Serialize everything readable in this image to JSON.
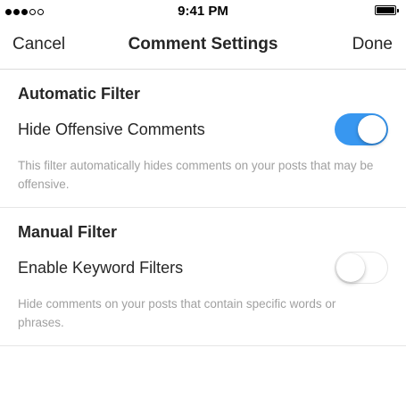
{
  "status_bar": {
    "time": "9:41 PM",
    "signal_bars_filled": 3,
    "signal_bars_total": 5,
    "battery_level": 1.0
  },
  "nav": {
    "cancel_label": "Cancel",
    "title": "Comment Settings",
    "done_label": "Done"
  },
  "sections": [
    {
      "header": "Automatic Filter",
      "row_label": "Hide Offensive Comments",
      "toggle_on": true,
      "description": "This filter automatically hides comments on your posts that may be offensive."
    },
    {
      "header": "Manual Filter",
      "row_label": "Enable Keyword Filters",
      "toggle_on": false,
      "description": "Hide comments on your posts that contain specific words or phrases."
    }
  ],
  "colors": {
    "toggle_on": "#3897f0",
    "description_text": "#a0a0a0",
    "primary_text": "#262626"
  }
}
